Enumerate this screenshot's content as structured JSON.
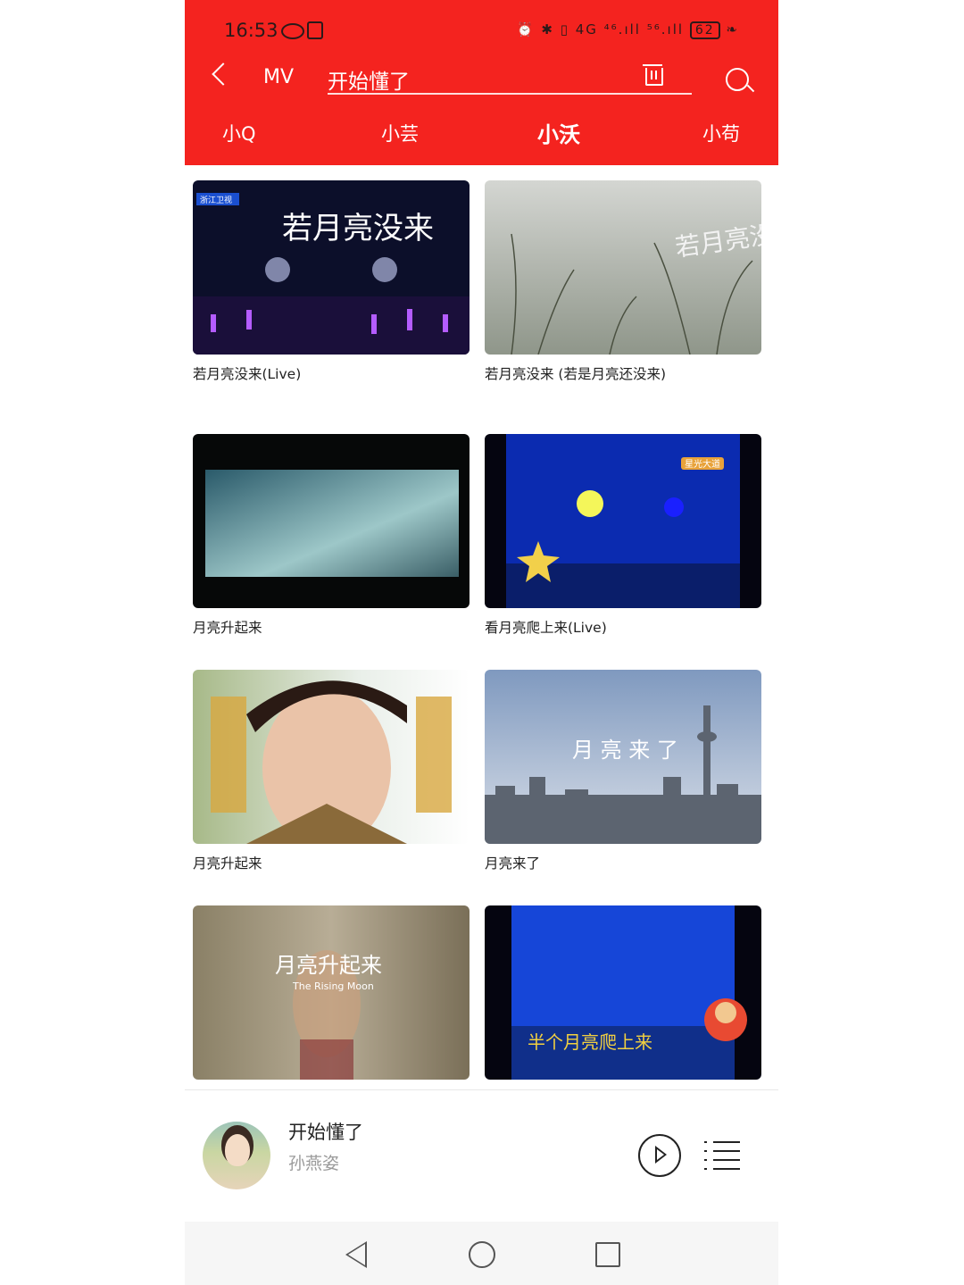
{
  "status_bar": {
    "time": "16:53",
    "right_icons": "⏰ ✱ ▯ 4G ⁴⁶.ıll ⁵⁶.ıll",
    "battery": "62"
  },
  "topbar": {
    "back_label": "‹",
    "section": "MV",
    "search_value": "开始懂了"
  },
  "tabs": [
    {
      "label": "小Q"
    },
    {
      "label": "小芸"
    },
    {
      "label": "小沃",
      "active": true
    },
    {
      "label": "小苟"
    }
  ],
  "videos": [
    {
      "title": "若月亮没来(Live)",
      "thumb_text": "若月亮没来",
      "thumb_badge": "浙江卫视"
    },
    {
      "title": "若月亮没来 (若是月亮还没来)",
      "thumb_text": "若月亮没来"
    },
    {
      "title": "月亮升起来"
    },
    {
      "title": "看月亮爬上来(Live)",
      "thumb_badge": "星光大道"
    },
    {
      "title": "月亮升起来"
    },
    {
      "title": "月亮来了",
      "thumb_text": "月 亮 来 了"
    },
    {
      "title": "",
      "thumb_text": "月亮升起来",
      "thumb_subtext": "The Rising Moon"
    },
    {
      "title": "",
      "thumb_text": "半个月亮爬上来"
    }
  ],
  "player": {
    "song": "开始懂了",
    "artist": "孙燕姿"
  },
  "colors": {
    "header": "#f4231f",
    "text": "#222222",
    "muted": "#9a9a9a"
  }
}
